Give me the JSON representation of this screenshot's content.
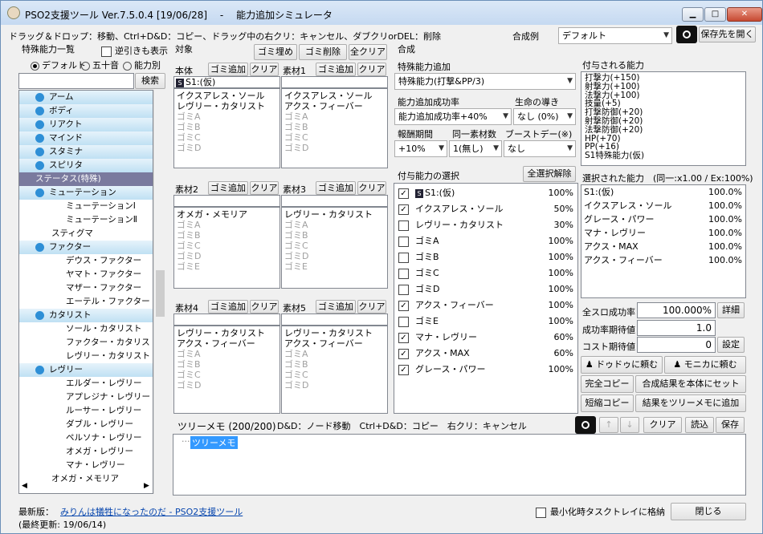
{
  "window": {
    "title": "PSO2支援ツール Ver.7.5.0.4 [19/06/28]　 -　 能力追加シミュレータ"
  },
  "hint": "ドラッグ＆ドロップ：移動、Ctrl+D&D：コピー、ドラッグ中の右クリ：キャンセル、ダブクリorDEL：削除",
  "preset": {
    "label": "合成例",
    "value": "デフォルト",
    "save_label": "保存先を開く"
  },
  "left": {
    "title": "特殊能力一覧",
    "reverse_label": "逆引きも表示",
    "radios": [
      "デフォルト",
      "五十音",
      "能力別"
    ],
    "search_button": "検索",
    "tree": [
      {
        "t": "アーム",
        "k": "cat",
        "i": 0
      },
      {
        "t": "ボディ",
        "k": "cat",
        "i": 0
      },
      {
        "t": "リアクト",
        "k": "cat",
        "i": 0
      },
      {
        "t": "マインド",
        "k": "cat",
        "i": 0
      },
      {
        "t": "スタミナ",
        "k": "cat",
        "i": 0
      },
      {
        "t": "スピリタ",
        "k": "cat",
        "i": 0
      },
      {
        "t": "ステータス(特殊)",
        "k": "head",
        "i": 0
      },
      {
        "t": "ミューテーション",
        "k": "sub",
        "i": 1
      },
      {
        "t": "ミューテーションⅠ",
        "k": "leaf",
        "i": 3
      },
      {
        "t": "ミューテーションⅡ",
        "k": "leaf",
        "i": 3
      },
      {
        "t": "スティグマ",
        "k": "leaf",
        "i": 2
      },
      {
        "t": "ファクター",
        "k": "sub",
        "i": 1
      },
      {
        "t": "デウス・ファクター",
        "k": "leaf",
        "i": 3
      },
      {
        "t": "ヤマト・ファクター",
        "k": "leaf",
        "i": 3
      },
      {
        "t": "マザー・ファクター",
        "k": "leaf",
        "i": 3
      },
      {
        "t": "エーテル・ファクター",
        "k": "leaf",
        "i": 3
      },
      {
        "t": "カタリスト",
        "k": "sub",
        "i": 1
      },
      {
        "t": "ソール・カタリスト",
        "k": "leaf",
        "i": 3
      },
      {
        "t": "ファクター・カタリスト",
        "k": "leaf",
        "i": 3
      },
      {
        "t": "レヴリー・カタリスト",
        "k": "leaf",
        "i": 3
      },
      {
        "t": "レヴリー",
        "k": "sub",
        "i": 1
      },
      {
        "t": "エルダー・レヴリー",
        "k": "leaf",
        "i": 3
      },
      {
        "t": "アプレジナ・レヴリー",
        "k": "leaf",
        "i": 3
      },
      {
        "t": "ルーサー・レヴリー",
        "k": "leaf",
        "i": 3
      },
      {
        "t": "ダブル・レヴリー",
        "k": "leaf",
        "i": 3
      },
      {
        "t": "ペルソナ・レヴリー",
        "k": "leaf",
        "i": 3
      },
      {
        "t": "オメガ・レヴリー",
        "k": "leaf",
        "i": 3
      },
      {
        "t": "マナ・レヴリー",
        "k": "leaf",
        "i": 3
      },
      {
        "t": "オメガ・メモリア",
        "k": "leaf",
        "i": 2
      }
    ]
  },
  "target": {
    "title": "対象",
    "fill_label": "ゴミ埋め",
    "delete_label": "ゴミ削除",
    "clearall_label": "全クリア",
    "add_label": "ゴミ追加",
    "clear_label": "クリア",
    "slots": [
      {
        "name": "本体",
        "header": "S1:(仮)",
        "items": [
          "イクスアレス・ソール",
          "レヴリー・カタリスト"
        ],
        "trash": [
          "ゴミA",
          "ゴミB",
          "ゴミC",
          "ゴミD"
        ]
      },
      {
        "name": "素材1",
        "header": "",
        "items": [
          "イクスアレス・ソール",
          "アクス・フィーバー"
        ],
        "trash": [
          "ゴミA",
          "ゴミB",
          "ゴミC",
          "ゴミD"
        ]
      },
      {
        "name": "素材2",
        "header": "",
        "items": [
          "オメガ・メモリア"
        ],
        "trash": [
          "ゴミA",
          "ゴミB",
          "ゴミC",
          "ゴミD",
          "ゴミE"
        ]
      },
      {
        "name": "素材3",
        "header": "",
        "items": [
          "レヴリー・カタリスト"
        ],
        "trash": [
          "ゴミA",
          "ゴミB",
          "ゴミC",
          "ゴミD",
          "ゴミE"
        ]
      },
      {
        "name": "素材4",
        "header": "",
        "items": [
          "レヴリー・カタリスト",
          "アクス・フィーバー"
        ],
        "trash": [
          "ゴミA",
          "ゴミB",
          "ゴミC",
          "ゴミD"
        ]
      },
      {
        "name": "素材5",
        "header": "",
        "items": [
          "レヴリー・カタリスト",
          "アクス・フィーバー"
        ],
        "trash": [
          "ゴミA",
          "ゴミB",
          "ゴミC",
          "ゴミD"
        ]
      }
    ]
  },
  "synth": {
    "title": "合成",
    "add_label": "特殊能力追加",
    "add_value": "特殊能力(打撃&PP/3)",
    "rate_label": "能力追加成功率",
    "rate_value": "能力追加成功率+40%",
    "life_label": "生命の導き",
    "life_value": "なし (0%)",
    "reward_label": "報酬期間",
    "reward_value": "+10%",
    "same_label": "同一素材数",
    "same_value": "1(無し)",
    "boost_label": "ブーストデー(※)",
    "boost_value": "なし",
    "select_title": "付与能力の選択",
    "deselect_label": "全選択解除",
    "abilities": [
      {
        "name": "S1:(仮)",
        "pct": "100%",
        "checked": true,
        "gray": false,
        "s1": true
      },
      {
        "name": "イクスアレス・ソール",
        "pct": "50%",
        "checked": true,
        "gray": false
      },
      {
        "name": "レヴリー・カタリスト",
        "pct": "30%",
        "checked": false,
        "gray": false
      },
      {
        "name": "ゴミA",
        "pct": "100%",
        "checked": false,
        "gray": true
      },
      {
        "name": "ゴミB",
        "pct": "100%",
        "checked": false,
        "gray": true
      },
      {
        "name": "ゴミC",
        "pct": "100%",
        "checked": false,
        "gray": true
      },
      {
        "name": "ゴミD",
        "pct": "100%",
        "checked": false,
        "gray": true
      },
      {
        "name": "アクス・フィーバー",
        "pct": "100%",
        "checked": true,
        "gray": false
      },
      {
        "name": "ゴミE",
        "pct": "100%",
        "checked": false,
        "gray": true
      },
      {
        "name": "マナ・レヴリー",
        "pct": "60%",
        "checked": true,
        "gray": false
      },
      {
        "name": "アクス・MAX",
        "pct": "60%",
        "checked": true,
        "gray": false
      },
      {
        "name": "グレース・パワー",
        "pct": "100%",
        "checked": true,
        "gray": false
      }
    ]
  },
  "granted": {
    "title": "付与される能力",
    "lines": [
      "打撃力(+150)",
      "射撃力(+100)",
      "法撃力(+100)",
      "技量(+5)",
      "打撃防御(+20)",
      "射撃防御(+20)",
      "法撃防御(+20)",
      "HP(+70)",
      "PP(+16)",
      "S1特殊能力(仮)"
    ]
  },
  "selected": {
    "title": "選択された能力　(同一:x1.00 / Ex:100%)",
    "rows": [
      [
        "S1:(仮)",
        "100.0%"
      ],
      [
        "イクスアレス・ソール",
        "100.0%"
      ],
      [
        "グレース・パワー",
        "100.0%"
      ],
      [
        "マナ・レヴリー",
        "100.0%"
      ],
      [
        "アクス・MAX",
        "100.0%"
      ],
      [
        "アクス・フィーバー",
        "100.0%"
      ]
    ]
  },
  "stats": {
    "rate_label": "全スロ成功率",
    "rate_value": "100.000%",
    "detail_label": "詳細",
    "expect_label": "成功率期待値",
    "expect_value": "1.0",
    "cost_label": "コスト期待値",
    "cost_value": "0",
    "setting_label": "設定"
  },
  "actions": {
    "dodo": "ドゥドゥに頼む",
    "monica": "モニカに頼む",
    "full_copy": "完全コピー",
    "set_body": "合成結果を本体にセット",
    "short_copy": "短縮コピー",
    "add_memo": "結果をツリーメモに追加"
  },
  "memo": {
    "title": "ツリーメモ (200/200)",
    "hint": "D&D：ノード移動　Ctrl+D&D：コピー　右クリ：キャンセル",
    "clear": "クリア",
    "load": "読込",
    "save": "保存",
    "node": "ツリーメモ"
  },
  "footer": {
    "latest_label": "最新版：",
    "latest_link": "みりんは犠牲になったのだ - PSO2支援ツール",
    "updated": "(最終更新: 19/06/14)",
    "tray_label": "最小化時タスクトレイに格納",
    "close_label": "閉じる"
  }
}
